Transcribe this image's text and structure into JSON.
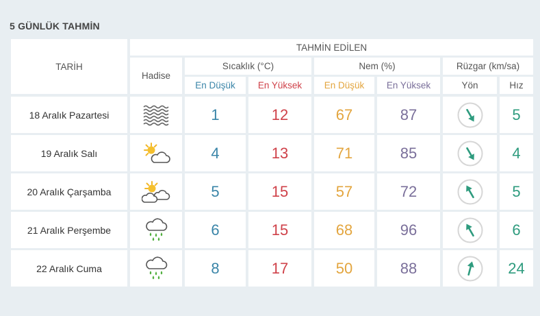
{
  "page_title": "5 GÜNLÜK TAHMİN",
  "headers": {
    "date": "TARİH",
    "forecast": "TAHMİN EDİLEN",
    "event": "Hadise",
    "temp": "Sıcaklık (°C)",
    "humidity": "Nem (%)",
    "wind": "Rüzgar (km/sa)",
    "temp_min": "En Düşük",
    "temp_max": "En Yüksek",
    "hum_min": "En Düşük",
    "hum_max": "En Yüksek",
    "wind_dir": "Yön",
    "wind_speed": "Hız"
  },
  "colors": {
    "blue": "#3a85a8",
    "red": "#cf4149",
    "orange": "#e3a53e",
    "purple": "#7a6f9a",
    "teal": "#2e9b7e"
  },
  "rows": [
    {
      "date": "18 Aralık Pazartesi",
      "icon": "fog-icon",
      "temp_min": "1",
      "temp_max": "12",
      "hum_min": "67",
      "hum_max": "87",
      "wind_dir_deg": 150,
      "wind_speed": "5"
    },
    {
      "date": "19 Aralık Salı",
      "icon": "partly-cloudy-icon",
      "temp_min": "4",
      "temp_max": "13",
      "hum_min": "71",
      "hum_max": "85",
      "wind_dir_deg": 150,
      "wind_speed": "4"
    },
    {
      "date": "20 Aralık Çarşamba",
      "icon": "sun-clouds-icon",
      "temp_min": "5",
      "temp_max": "15",
      "hum_min": "57",
      "hum_max": "72",
      "wind_dir_deg": 330,
      "wind_speed": "5"
    },
    {
      "date": "21 Aralık Perşembe",
      "icon": "rain-icon",
      "temp_min": "6",
      "temp_max": "15",
      "hum_min": "68",
      "hum_max": "96",
      "wind_dir_deg": 330,
      "wind_speed": "6"
    },
    {
      "date": "22 Aralık Cuma",
      "icon": "rain-icon",
      "temp_min": "8",
      "temp_max": "17",
      "hum_min": "50",
      "hum_max": "88",
      "wind_dir_deg": 15,
      "wind_speed": "24"
    }
  ]
}
